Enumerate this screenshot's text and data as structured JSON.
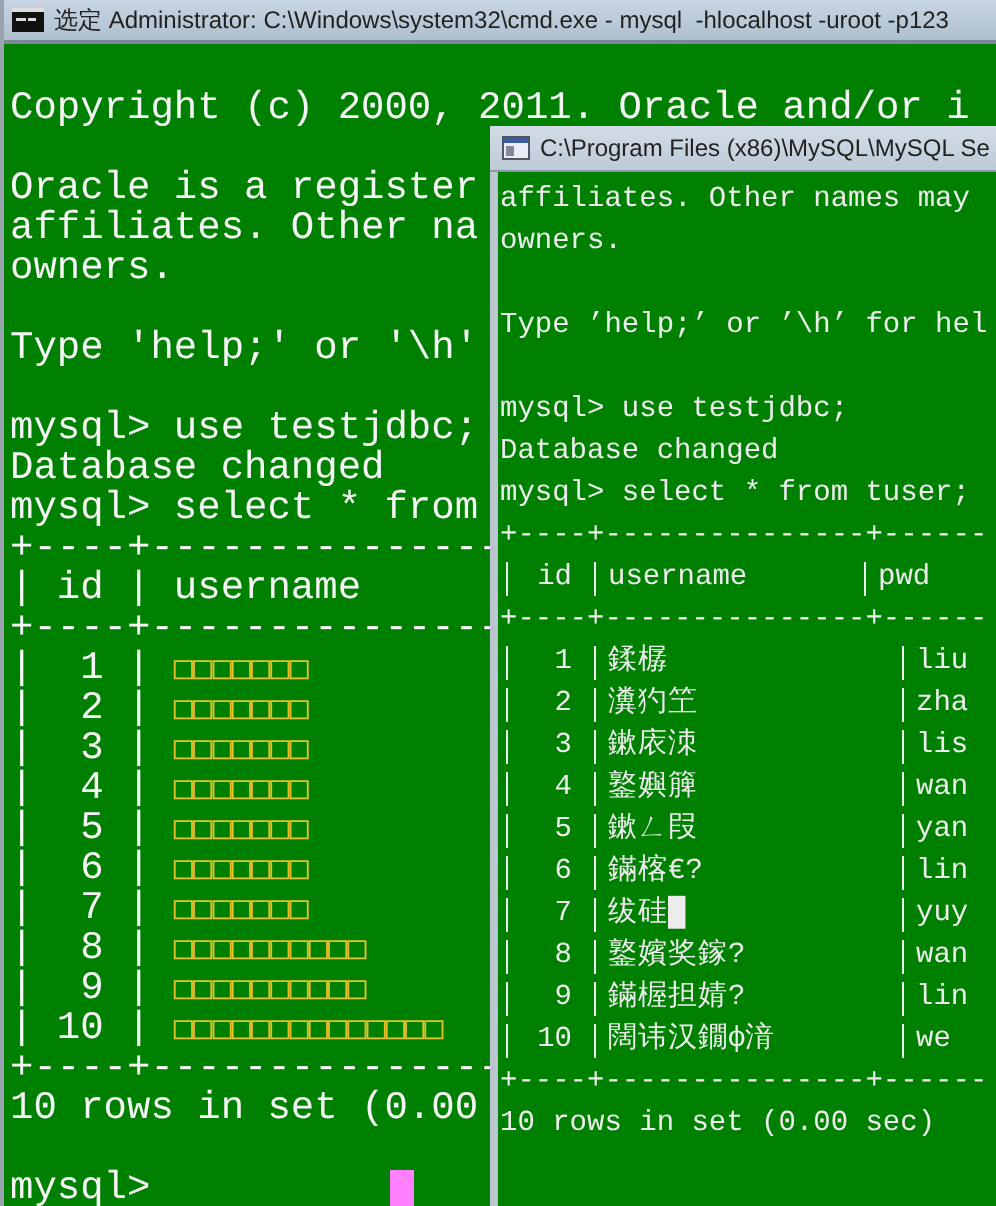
{
  "back_window": {
    "title": "选定 Administrator: C:\\Windows\\system32\\cmd.exe - mysql  -hlocalhost -uroot -p123",
    "lines": [
      {
        "kind": "blank"
      },
      {
        "kind": "text",
        "text": "Copyright (c) 2000, 2011. Oracle and/or i"
      },
      {
        "kind": "blank"
      },
      {
        "kind": "text",
        "text": "Oracle is a register"
      },
      {
        "kind": "text",
        "text": "affiliates. Other na"
      },
      {
        "kind": "text",
        "text": "owners."
      },
      {
        "kind": "blank"
      },
      {
        "kind": "text",
        "text": "Type 'help;' or '\\h'"
      },
      {
        "kind": "blank"
      },
      {
        "kind": "text",
        "text": "mysql> use testjdbc;"
      },
      {
        "kind": "text",
        "text": "Database changed"
      },
      {
        "kind": "text",
        "text": "mysql> select * from"
      },
      {
        "kind": "text",
        "text": "+----+---------------"
      },
      {
        "kind": "text",
        "text": "| id | username"
      },
      {
        "kind": "text",
        "text": "+----+---------------"
      },
      {
        "kind": "row",
        "text": "|  1 |",
        "value": "□□□□□□□"
      },
      {
        "kind": "row",
        "text": "|  2 |",
        "value": "□□□□□□□"
      },
      {
        "kind": "row",
        "text": "|  3 |",
        "value": "□□□□□□□"
      },
      {
        "kind": "row",
        "text": "|  4 |",
        "value": "□□□□□□□"
      },
      {
        "kind": "row",
        "text": "|  5 |",
        "value": "□□□□□□□"
      },
      {
        "kind": "row",
        "text": "|  6 |",
        "value": "□□□□□□□"
      },
      {
        "kind": "row",
        "text": "|  7 |",
        "value": "□□□□□□□"
      },
      {
        "kind": "row",
        "text": "|  8 |",
        "value": "□□□□□□□□□□"
      },
      {
        "kind": "row",
        "text": "|  9 |",
        "value": "□□□□□□□□□□"
      },
      {
        "kind": "row",
        "text": "| 10 |",
        "value": "□□□□□□□□□□□□□□"
      },
      {
        "kind": "text",
        "text": "+----+---------------"
      },
      {
        "kind": "text",
        "text": "10 rows in set (0.00"
      },
      {
        "kind": "blank"
      },
      {
        "kind": "prompt",
        "text": "mysql>"
      }
    ]
  },
  "front_window": {
    "title": "C:\\Program Files (x86)\\MySQL\\MySQL Se",
    "lines": [
      {
        "kind": "text",
        "text": "affiliates. Other names may"
      },
      {
        "kind": "text",
        "text": "owners."
      },
      {
        "kind": "blank"
      },
      {
        "kind": "text",
        "text": "Type ’help;’ or ’\\h’ for hel"
      },
      {
        "kind": "blank"
      },
      {
        "kind": "text",
        "text": "mysql> use testjdbc;"
      },
      {
        "kind": "text",
        "text": "Database changed"
      },
      {
        "kind": "text",
        "text": "mysql> select * from tuser;"
      },
      {
        "kind": "text",
        "text": "+----+---------------+------"
      },
      {
        "kind": "header",
        "cells": [
          "id",
          "username",
          "pwd"
        ]
      },
      {
        "kind": "text",
        "text": "+----+---------------+------"
      },
      {
        "kind": "row",
        "cells": [
          "1",
          "鍒樼",
          "liu"
        ]
      },
      {
        "kind": "row",
        "cells": [
          "2",
          "瀵犳笁",
          "zha"
        ]
      },
      {
        "kind": "row",
        "cells": [
          "3",
          "鏉庡洓",
          "lis"
        ]
      },
      {
        "kind": "row",
        "cells": [
          "4",
          "鐜嬩簲",
          "wan"
        ]
      },
      {
        "kind": "row",
        "cells": [
          "5",
          "鏉ㄥ叚",
          "yan"
        ]
      },
      {
        "kind": "row",
        "cells": [
          "6",
          "鏋楁€?",
          "lin"
        ]
      },
      {
        "kind": "row",
        "cells": [
          "7",
          "绂硅█",
          "yuy"
        ]
      },
      {
        "kind": "row",
        "cells": [
          "8",
          "鐜嬪奖鎵?",
          "wan"
        ]
      },
      {
        "kind": "row",
        "cells": [
          "9",
          "鏋楃担婧?",
          "lin"
        ]
      },
      {
        "kind": "row",
        "cells": [
          "10",
          "闊讳汉鐗ф湇",
          "we"
        ]
      },
      {
        "kind": "text",
        "text": "+----+---------------+------"
      },
      {
        "kind": "text",
        "text": "10 rows in set (0.00 sec)"
      }
    ]
  }
}
